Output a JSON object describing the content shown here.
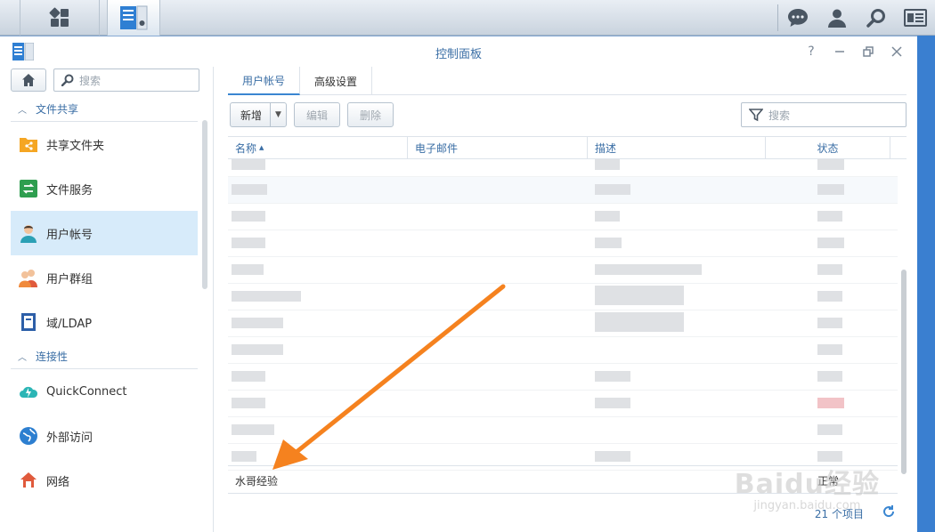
{
  "window": {
    "title": "控制面板",
    "help_label": "?"
  },
  "sidebar": {
    "search_placeholder": "搜索",
    "sections": [
      {
        "label": "文件共享"
      },
      {
        "label": "连接性"
      }
    ],
    "items": [
      {
        "label": "共享文件夹",
        "icon": "shared-folder-icon"
      },
      {
        "label": "文件服务",
        "icon": "file-services-icon"
      },
      {
        "label": "用户帐号",
        "icon": "user-icon",
        "active": true
      },
      {
        "label": "用户群组",
        "icon": "group-icon"
      },
      {
        "label": "域/LDAP",
        "icon": "ldap-icon"
      },
      {
        "label": "QuickConnect",
        "icon": "quickconnect-icon"
      },
      {
        "label": "外部访问",
        "icon": "external-access-icon"
      },
      {
        "label": "网络",
        "icon": "network-icon"
      }
    ]
  },
  "tabs": [
    {
      "label": "用户帐号",
      "active": true
    },
    {
      "label": "高级设置",
      "active": false
    }
  ],
  "toolbar": {
    "new_label": "新增",
    "edit_label": "编辑",
    "delete_label": "删除",
    "search_placeholder": "搜索"
  },
  "table": {
    "columns": [
      "名称",
      "电子邮件",
      "描述",
      "状态"
    ],
    "sort_indicator": "▲",
    "visible_row": {
      "name": "水哥经验",
      "status": "正常"
    }
  },
  "footer": {
    "count_text": "21 个项目"
  },
  "watermark": {
    "brand": "Baidu经验",
    "site": "jingyan.baidu.com"
  },
  "colors": {
    "accent": "#3a6ea5",
    "active_bg": "#d7ebfa",
    "arrow": "#f5821f"
  }
}
